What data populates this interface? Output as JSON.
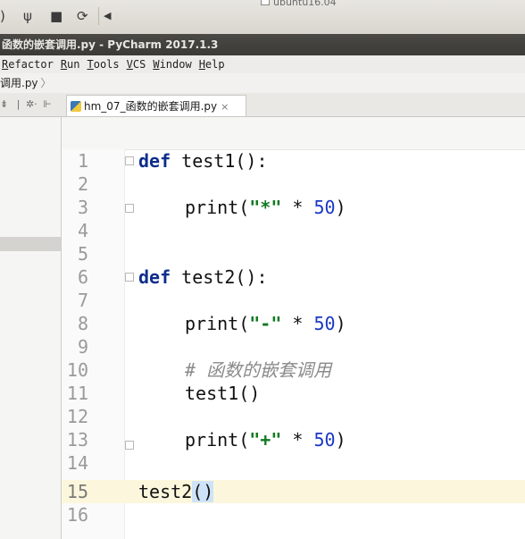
{
  "system_bar": {
    "host_label": "ubuntu16.04",
    "icons": [
      "speaker-icon",
      "usb-icon",
      "save-icon",
      "sync-icon",
      "arrow-left-icon"
    ]
  },
  "window": {
    "title": "函数的嵌套调用.py - PyCharm 2017.1.3"
  },
  "menu": {
    "items": [
      "Refactor",
      "Run",
      "Tools",
      "VCS",
      "Window",
      "Help"
    ]
  },
  "breadcrumb": {
    "label": "调用.py"
  },
  "tab": {
    "label": "hm_07_函数的嵌套调用.py",
    "close": "×"
  },
  "editor": {
    "lines": [
      {
        "n": "1"
      },
      {
        "n": "2"
      },
      {
        "n": "3"
      },
      {
        "n": "4"
      },
      {
        "n": "5"
      },
      {
        "n": "6"
      },
      {
        "n": "7"
      },
      {
        "n": "8"
      },
      {
        "n": "9"
      },
      {
        "n": "10"
      },
      {
        "n": "11"
      },
      {
        "n": "12"
      },
      {
        "n": "13"
      },
      {
        "n": "14"
      },
      {
        "n": "15"
      },
      {
        "n": "16"
      }
    ],
    "tokens": {
      "def": "def",
      "test1_sig": "test1():",
      "test2_sig": "test2():",
      "print": "print",
      "lp": "(",
      "rp": ")",
      "star_str": "\"*\"",
      "dash_str": "\"-\"",
      "plus_str": "\"+\"",
      "mul": " * ",
      "fifty": "50",
      "comment": "# 函数的嵌套调用",
      "call_test1": "test1()",
      "call_test2_name": "test2",
      "call_parens": "()"
    },
    "current_line": 15
  }
}
